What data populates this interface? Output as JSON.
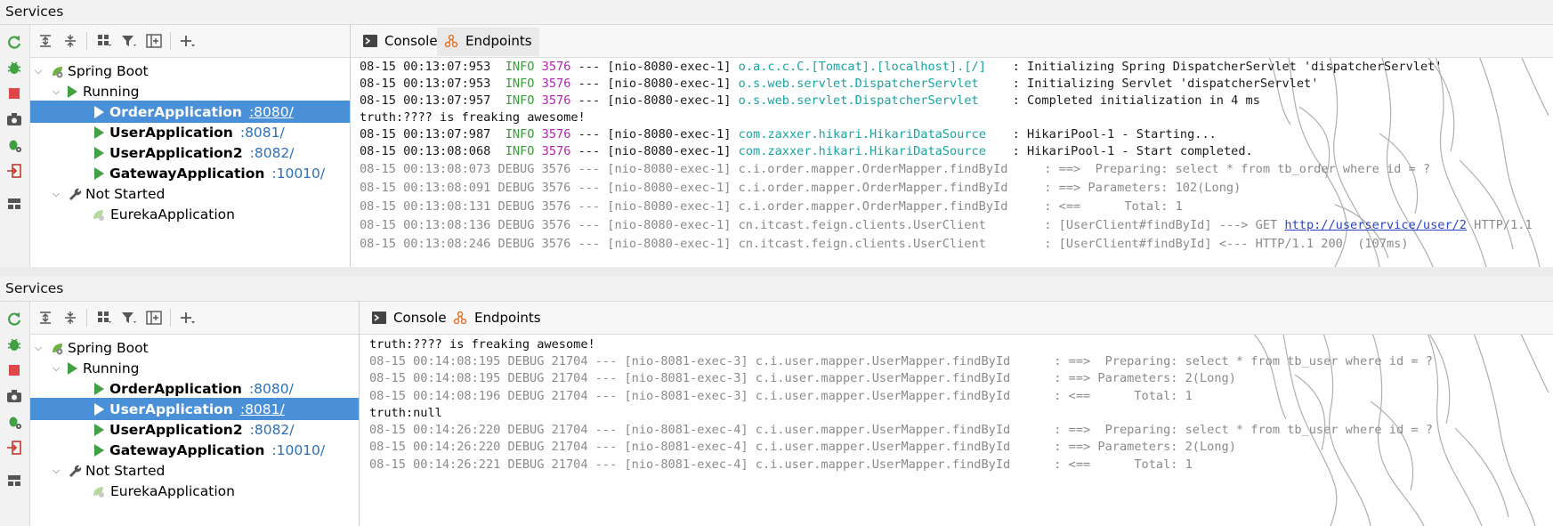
{
  "panels": [
    {
      "title": "Services",
      "tabs": [
        {
          "label": "Console"
        },
        {
          "label": "Endpoints"
        }
      ],
      "tree": {
        "root": "Spring Boot",
        "running": "Running",
        "apps": [
          {
            "name": "OrderApplication",
            "port": ":8080/"
          },
          {
            "name": "UserApplication",
            "port": ":8081/"
          },
          {
            "name": "UserApplication2",
            "port": ":8082/"
          },
          {
            "name": "GatewayApplication",
            "port": ":10010/"
          }
        ],
        "not_started": "Not Started",
        "stopped_app": "EurekaApplication"
      },
      "log": [
        {
          "ts": "08-15 00:13:07:953",
          "level": "INFO",
          "pid": "3576",
          "sep": "---",
          "thread": "[nio-8080-exec-1]",
          "logger": "o.a.c.c.C.[Tomcat].[localhost].[/]",
          "msg": ": Initializing Spring DispatcherServlet 'dispatcherServlet'"
        },
        {
          "ts": "08-15 00:13:07:953",
          "level": "INFO",
          "pid": "3576",
          "sep": "---",
          "thread": "[nio-8080-exec-1]",
          "logger": "o.s.web.servlet.DispatcherServlet",
          "msg": ": Initializing Servlet 'dispatcherServlet'"
        },
        {
          "ts": "08-15 00:13:07:957",
          "level": "INFO",
          "pid": "3576",
          "sep": "---",
          "thread": "[nio-8080-exec-1]",
          "logger": "o.s.web.servlet.DispatcherServlet",
          "msg": ": Completed initialization in 4 ms"
        },
        {
          "plain": "truth:???? is freaking awesome!"
        },
        {
          "ts": "08-15 00:13:07:987",
          "level": "INFO",
          "pid": "3576",
          "sep": "---",
          "thread": "[nio-8080-exec-1]",
          "logger": "com.zaxxer.hikari.HikariDataSource",
          "msg": ": HikariPool-1 - Starting..."
        },
        {
          "ts": "08-15 00:13:08:068",
          "level": "INFO",
          "pid": "3576",
          "sep": "---",
          "thread": "[nio-8080-exec-1]",
          "logger": "com.zaxxer.hikari.HikariDataSource",
          "msg": ": HikariPool-1 - Start completed."
        },
        {
          "debug": "08-15 00:13:08:073 DEBUG 3576 --- [nio-8080-exec-1] c.i.order.mapper.OrderMapper.findById     : ==>  Preparing: select * from tb_order where id = ?"
        },
        {
          "debug": "08-15 00:13:08:091 DEBUG 3576 --- [nio-8080-exec-1] c.i.order.mapper.OrderMapper.findById     : ==> Parameters: 102(Long)"
        },
        {
          "debug": "08-15 00:13:08:131 DEBUG 3576 --- [nio-8080-exec-1] c.i.order.mapper.OrderMapper.findById     : <==      Total: 1"
        },
        {
          "debug": "08-15 00:13:08:136 DEBUG 3576 --- [nio-8080-exec-1] cn.itcast.feign.clients.UserClient        : [UserClient#findById] ---> GET ",
          "link": "http://userservice/user/2",
          "tail": " HTTP/1.1"
        },
        {
          "debug": "08-15 00:13:08:246 DEBUG 3576 --- [nio-8080-exec-1] cn.itcast.feign.clients.UserClient        : [UserClient#findById] <--- HTTP/1.1 200  (107ms)"
        }
      ]
    },
    {
      "title": "Services",
      "tabs": [
        {
          "label": "Console"
        },
        {
          "label": "Endpoints"
        }
      ],
      "tree": {
        "root": "Spring Boot",
        "running": "Running",
        "apps": [
          {
            "name": "OrderApplication",
            "port": ":8080/"
          },
          {
            "name": "UserApplication",
            "port": ":8081/"
          },
          {
            "name": "UserApplication2",
            "port": ":8082/"
          },
          {
            "name": "GatewayApplication",
            "port": ":10010/"
          }
        ],
        "not_started": "Not Started",
        "stopped_app": "EurekaApplication"
      },
      "log": [
        {
          "plain": "truth:???? is freaking awesome!"
        },
        {
          "debug": "08-15 00:14:08:195 DEBUG 21704 --- [nio-8081-exec-3] c.i.user.mapper.UserMapper.findById      : ==>  Preparing: select * from tb_user where id = ?"
        },
        {
          "debug": "08-15 00:14:08:195 DEBUG 21704 --- [nio-8081-exec-3] c.i.user.mapper.UserMapper.findById      : ==> Parameters: 2(Long)"
        },
        {
          "debug": "08-15 00:14:08:196 DEBUG 21704 --- [nio-8081-exec-3] c.i.user.mapper.UserMapper.findById      : <==      Total: 1"
        },
        {
          "plain": "truth:null"
        },
        {
          "debug": "08-15 00:14:26:220 DEBUG 21704 --- [nio-8081-exec-4] c.i.user.mapper.UserMapper.findById      : ==>  Preparing: select * from tb_user where id = ?"
        },
        {
          "debug": "08-15 00:14:26:220 DEBUG 21704 --- [nio-8081-exec-4] c.i.user.mapper.UserMapper.findById      : ==> Parameters: 2(Long)"
        },
        {
          "debug": "08-15 00:14:26:221 DEBUG 21704 --- [nio-8081-exec-4] c.i.user.mapper.UserMapper.findById      : <==      Total: 1"
        }
      ]
    }
  ],
  "colors": {
    "selection": "#4a90d9",
    "run": "#3fa142",
    "info": "#3a9c3a",
    "pid": "#b024b0",
    "logger": "#1aa3a3",
    "debug": "#8a8a8a",
    "port": "#2e6fb7"
  },
  "icons": [
    "rerun-icon",
    "debug-icon",
    "stop-icon",
    "snapshot-icon",
    "debug-settings-icon",
    "login-icon",
    "layout-icon",
    "expand-all-icon",
    "collapse-all-icon",
    "group-icon",
    "filter-icon",
    "add-config-icon",
    "add-icon",
    "console-icon",
    "endpoints-icon",
    "spring-boot-icon",
    "wrench-icon",
    "spring-leaf-icon"
  ]
}
